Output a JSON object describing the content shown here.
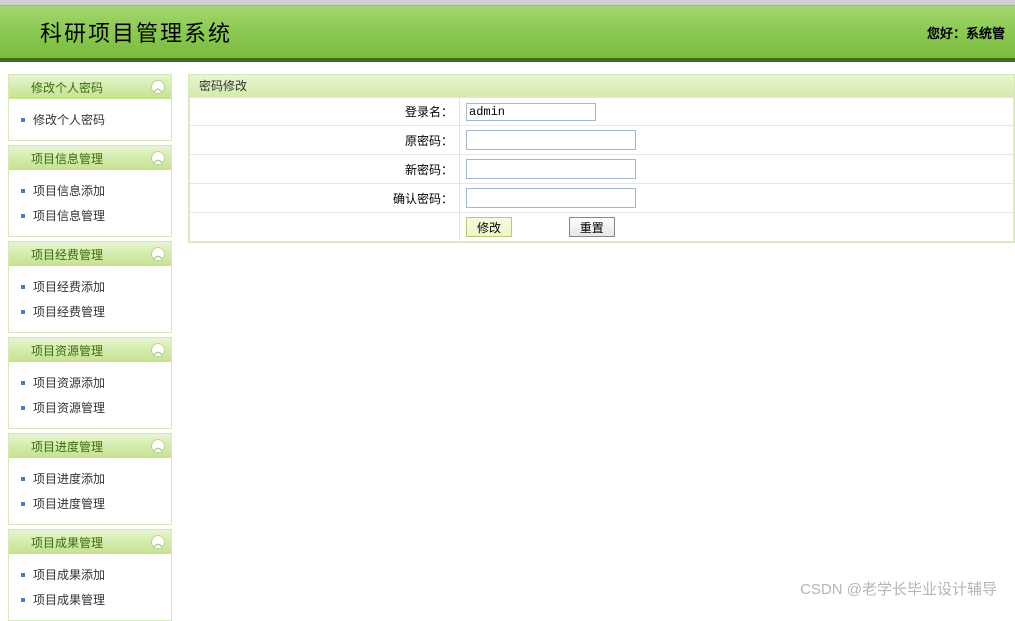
{
  "header": {
    "title": "科研项目管理系统",
    "greeting": "您好：系统管"
  },
  "sidebar": {
    "groups": [
      {
        "title": "修改个人密码",
        "items": [
          {
            "label": "修改个人密码"
          }
        ]
      },
      {
        "title": "项目信息管理",
        "items": [
          {
            "label": "项目信息添加"
          },
          {
            "label": "项目信息管理"
          }
        ]
      },
      {
        "title": "项目经费管理",
        "items": [
          {
            "label": "项目经费添加"
          },
          {
            "label": "项目经费管理"
          }
        ]
      },
      {
        "title": "项目资源管理",
        "items": [
          {
            "label": "项目资源添加"
          },
          {
            "label": "项目资源管理"
          }
        ]
      },
      {
        "title": "项目进度管理",
        "items": [
          {
            "label": "项目进度添加"
          },
          {
            "label": "项目进度管理"
          }
        ]
      },
      {
        "title": "项目成果管理",
        "items": [
          {
            "label": "项目成果添加"
          },
          {
            "label": "项目成果管理"
          }
        ]
      }
    ]
  },
  "main": {
    "panel_title": "密码修改",
    "form": {
      "login_label": "登录名：",
      "login_value": "admin",
      "old_pwd_label": "原密码：",
      "old_pwd_value": "",
      "new_pwd_label": "新密码：",
      "new_pwd_value": "",
      "confirm_pwd_label": "确认密码：",
      "confirm_pwd_value": "",
      "submit_label": "修改",
      "reset_label": "重置"
    }
  },
  "watermark": "CSDN @老学长毕业设计辅导"
}
